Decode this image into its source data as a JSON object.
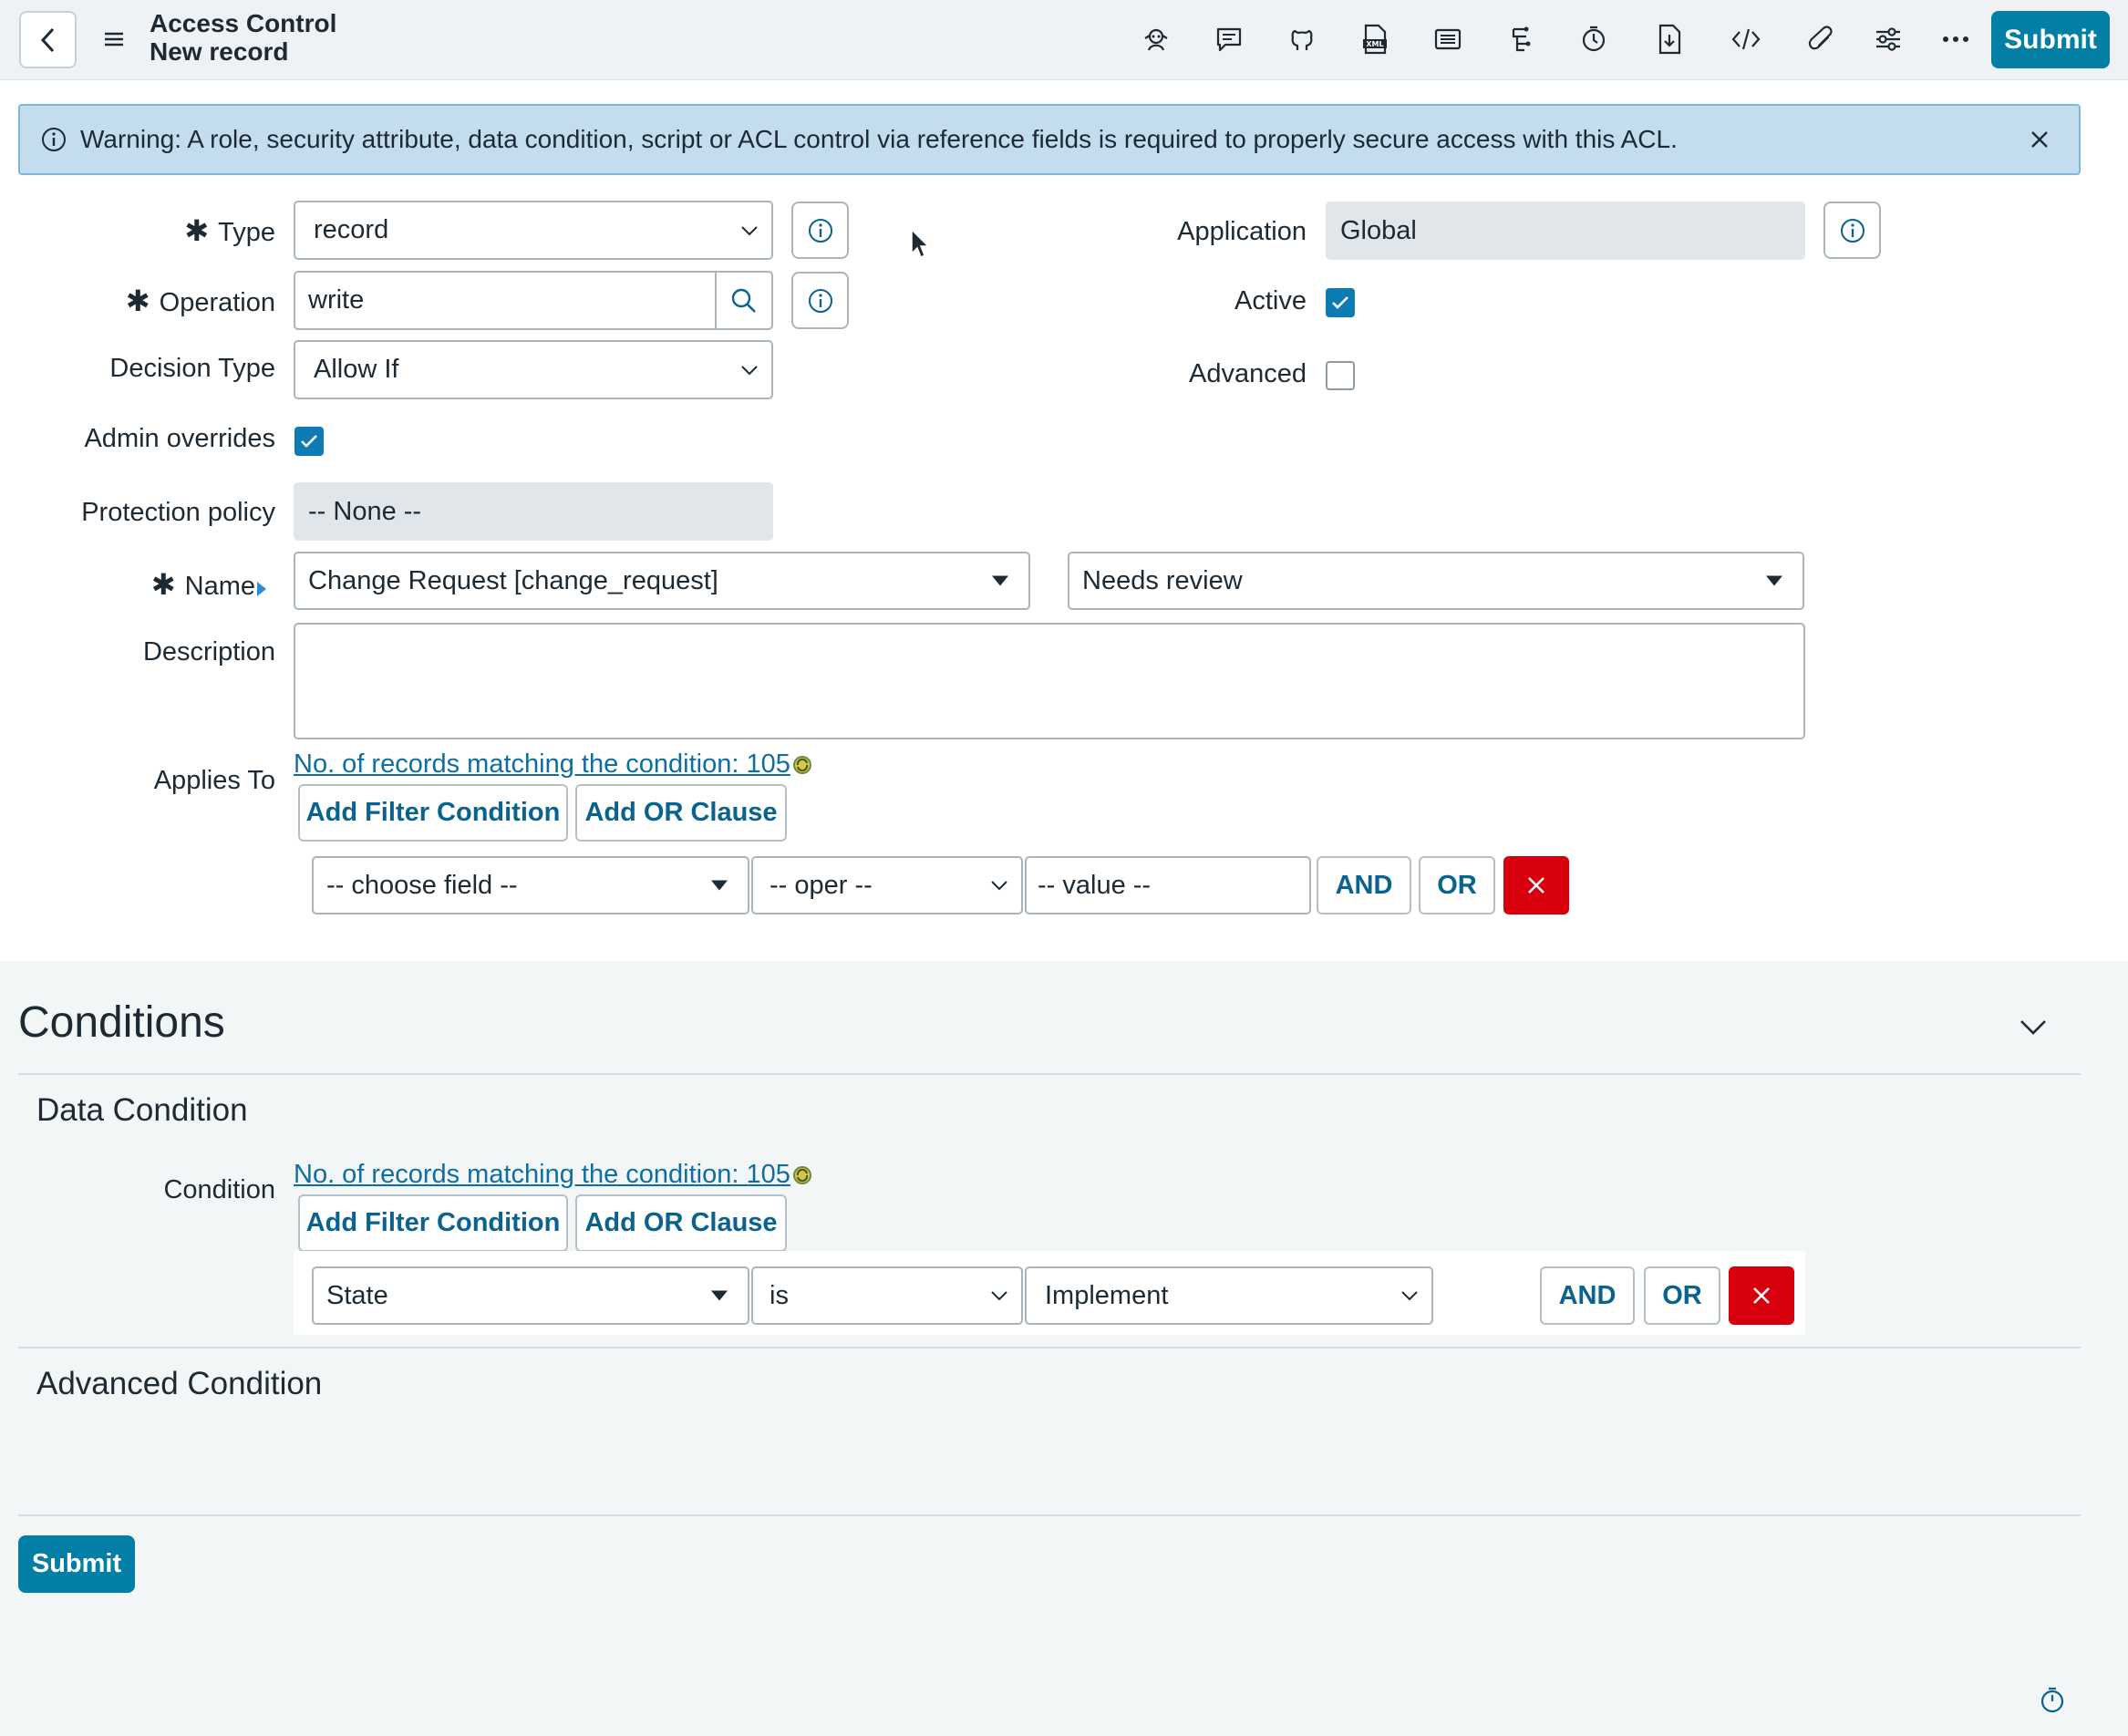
{
  "header": {
    "title": "Access Control",
    "subtitle": "New record",
    "submit_label": "Submit",
    "toolbar_icons": [
      "agent-icon",
      "comment-icon",
      "github-icon",
      "xml-icon",
      "list-icon",
      "flow-icon",
      "clock-icon",
      "download-icon",
      "code-icon",
      "attachment-icon",
      "sliders-icon",
      "more-icon"
    ]
  },
  "warning": {
    "text": "Warning: A role, security attribute, data condition, script or ACL control via reference fields is required to properly secure access with this ACL."
  },
  "form": {
    "type_label": "Type",
    "type_value": "record",
    "operation_label": "Operation",
    "operation_value": "write",
    "decision_type_label": "Decision Type",
    "decision_type_value": "Allow If",
    "admin_overrides_label": "Admin overrides",
    "admin_overrides_checked": true,
    "protection_policy_label": "Protection policy",
    "protection_policy_value": "-- None --",
    "name_label": "Name",
    "name_value": "Change Request [change_request]",
    "name_field_value": "Needs review",
    "description_label": "Description",
    "description_value": "",
    "application_label": "Application",
    "application_value": "Global",
    "active_label": "Active",
    "active_checked": true,
    "advanced_label": "Advanced",
    "advanced_checked": false,
    "applies_to_label": "Applies To"
  },
  "applies_to": {
    "records_link": "No. of records matching the condition: 105",
    "add_filter_label": "Add Filter Condition",
    "add_or_label": "Add OR Clause",
    "field_placeholder": "-- choose field --",
    "oper_placeholder": "-- oper --",
    "value_placeholder": "-- value --",
    "and_label": "AND",
    "or_label": "OR"
  },
  "conditions": {
    "title": "Conditions",
    "data_condition_title": "Data Condition",
    "condition_label": "Condition",
    "records_link": "No. of records matching the condition: 105",
    "add_filter_label": "Add Filter Condition",
    "add_or_label": "Add OR Clause",
    "field_value": "State",
    "oper_value": "is",
    "value_value": "Implement",
    "and_label": "AND",
    "or_label": "OR",
    "advanced_condition_title": "Advanced Condition",
    "submit_label": "Submit"
  },
  "colors": {
    "accent": "#037ea5",
    "warning_bg": "#c3ddef",
    "delete": "#d8000c"
  }
}
